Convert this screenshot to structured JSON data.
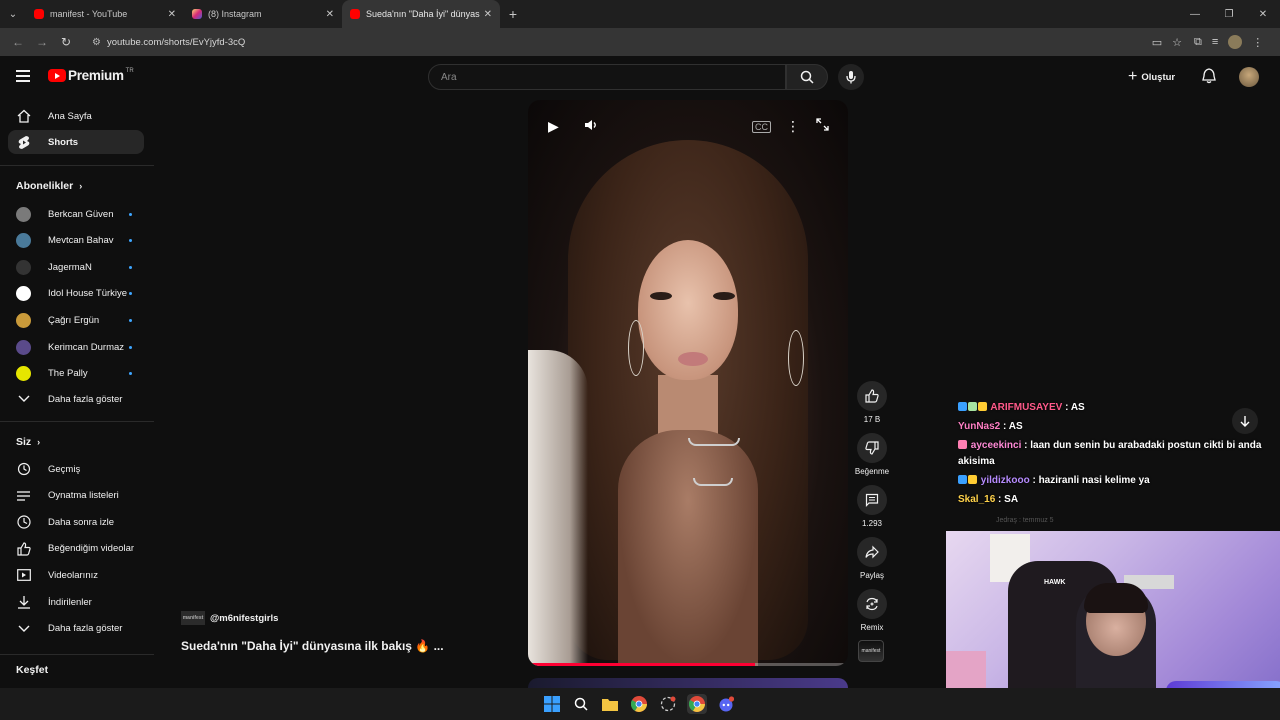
{
  "browser": {
    "tabs": [
      {
        "title": "manifest - YouTube",
        "icon": "youtube-icon"
      },
      {
        "title": "(8) Instagram",
        "icon": "instagram-icon"
      },
      {
        "title": "Sueda'nın \"Daha İyi\" dünyasına",
        "icon": "youtube-icon"
      }
    ],
    "url": "youtube.com/shorts/EvYjyfd-3cQ"
  },
  "masthead": {
    "logo_text": "Premium",
    "country": "TR",
    "search_placeholder": "Ara",
    "create_label": "Oluştur"
  },
  "sidebar": {
    "main": [
      {
        "label": "Ana Sayfa",
        "icon": "home-icon"
      },
      {
        "label": "Shorts",
        "icon": "shorts-icon"
      }
    ],
    "subs_heading": "Abonelikler",
    "subscriptions": [
      {
        "label": "Berkcan Güven",
        "color": "#7a7a7a"
      },
      {
        "label": "Mevtcan Bahav",
        "color": "#4a7a9a"
      },
      {
        "label": "JagermaN",
        "color": "#333333"
      },
      {
        "label": "Idol House Türkiye",
        "color": "#ffffff"
      },
      {
        "label": "Çağrı Ergün",
        "color": "#c99a3a"
      },
      {
        "label": "Kerimcan Durmaz",
        "color": "#5a4a8a"
      },
      {
        "label": "The Pally",
        "color": "#e6e600"
      }
    ],
    "more_subs": "Daha fazla göster",
    "you_heading": "Siz",
    "you_items": [
      {
        "label": "Geçmiş",
        "icon": "history-icon"
      },
      {
        "label": "Oynatma listeleri",
        "icon": "playlist-icon"
      },
      {
        "label": "Daha sonra izle",
        "icon": "clock-icon"
      },
      {
        "label": "Beğendiğim videolar",
        "icon": "thumb-up-icon"
      },
      {
        "label": "Videolarınız",
        "icon": "video-icon"
      },
      {
        "label": "İndirilenler",
        "icon": "download-icon"
      },
      {
        "label": "Daha fazla göster",
        "icon": "chevron-down-icon"
      }
    ],
    "explore_heading": "Keşfet"
  },
  "short": {
    "channel": "@m6nifestgirls",
    "channel_thumb": "manifest",
    "title": "Sueda'nın \"Daha İyi\" dünyasına ilk bakış 🔥 ...",
    "progress": 0.71,
    "actions": {
      "like_count": "17 B",
      "dislike_label": "Beğenme",
      "comment_count": "1.293",
      "share_label": "Paylaş",
      "remix_label": "Remix"
    }
  },
  "stream_overlay": {
    "chat": [
      {
        "user": "ARIFMUSAYEV",
        "message": "AS",
        "user_color": "#ff5a8a"
      },
      {
        "user": "YunNas2",
        "message": "AS",
        "user_color": "#ff7fc4"
      },
      {
        "user": "ayceekinci",
        "message": "laan dun senin bu arabadaki postun cikti bi anda akisima",
        "user_color": "#ff8ad6"
      },
      {
        "user": "yildizkooo",
        "message": "haziranli nasi kelime ya",
        "user_color": "#b78cff"
      },
      {
        "user": "Skal_16",
        "message": "SA",
        "user_color": "#ffd24a"
      }
    ],
    "faded_line": "Jedraş : temmuz 5",
    "chair_brand": "HAWK"
  },
  "colors": {
    "accent": "#ff0033",
    "background": "#0f0f0f",
    "chip": "#272727"
  }
}
